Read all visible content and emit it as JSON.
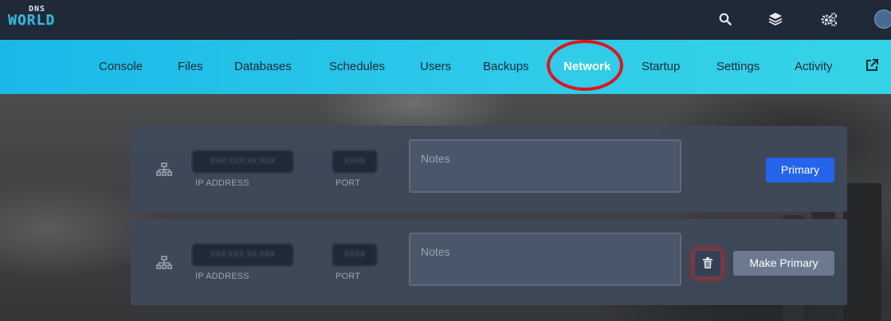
{
  "brand": {
    "logo_small": "DNS",
    "logo_big": "WORLD"
  },
  "topbar": {
    "icons": [
      "search-icon",
      "layers-icon",
      "cogs-icon",
      "avatar"
    ]
  },
  "nav": {
    "items": [
      {
        "label": "Console"
      },
      {
        "label": "Files"
      },
      {
        "label": "Databases"
      },
      {
        "label": "Schedules"
      },
      {
        "label": "Users"
      },
      {
        "label": "Backups"
      },
      {
        "label": "Network",
        "active": true
      },
      {
        "label": "Startup"
      },
      {
        "label": "Settings"
      },
      {
        "label": "Activity"
      }
    ],
    "external_icon": "external-link-icon",
    "accent": "#1ab8e8",
    "highlight_ring_color": "#e0141b"
  },
  "allocations": [
    {
      "icon": "network-icon",
      "ip": "XXX.XXX.XX.XXX",
      "ip_label": "IP ADDRESS",
      "port": "XXXX",
      "port_label": "PORT",
      "notes_placeholder": "Notes",
      "primary_label": "Primary"
    },
    {
      "icon": "network-icon",
      "ip": "XXX.XXX.XX.XXX",
      "ip_label": "IP ADDRESS",
      "port": "XXXX",
      "port_label": "PORT",
      "notes_placeholder": "Notes",
      "delete_icon": "trash-icon",
      "make_primary_label": "Make Primary"
    }
  ],
  "colors": {
    "primary_button": "#2563eb",
    "card_bg": "#3e4958",
    "topbar_bg": "#1f2937"
  }
}
